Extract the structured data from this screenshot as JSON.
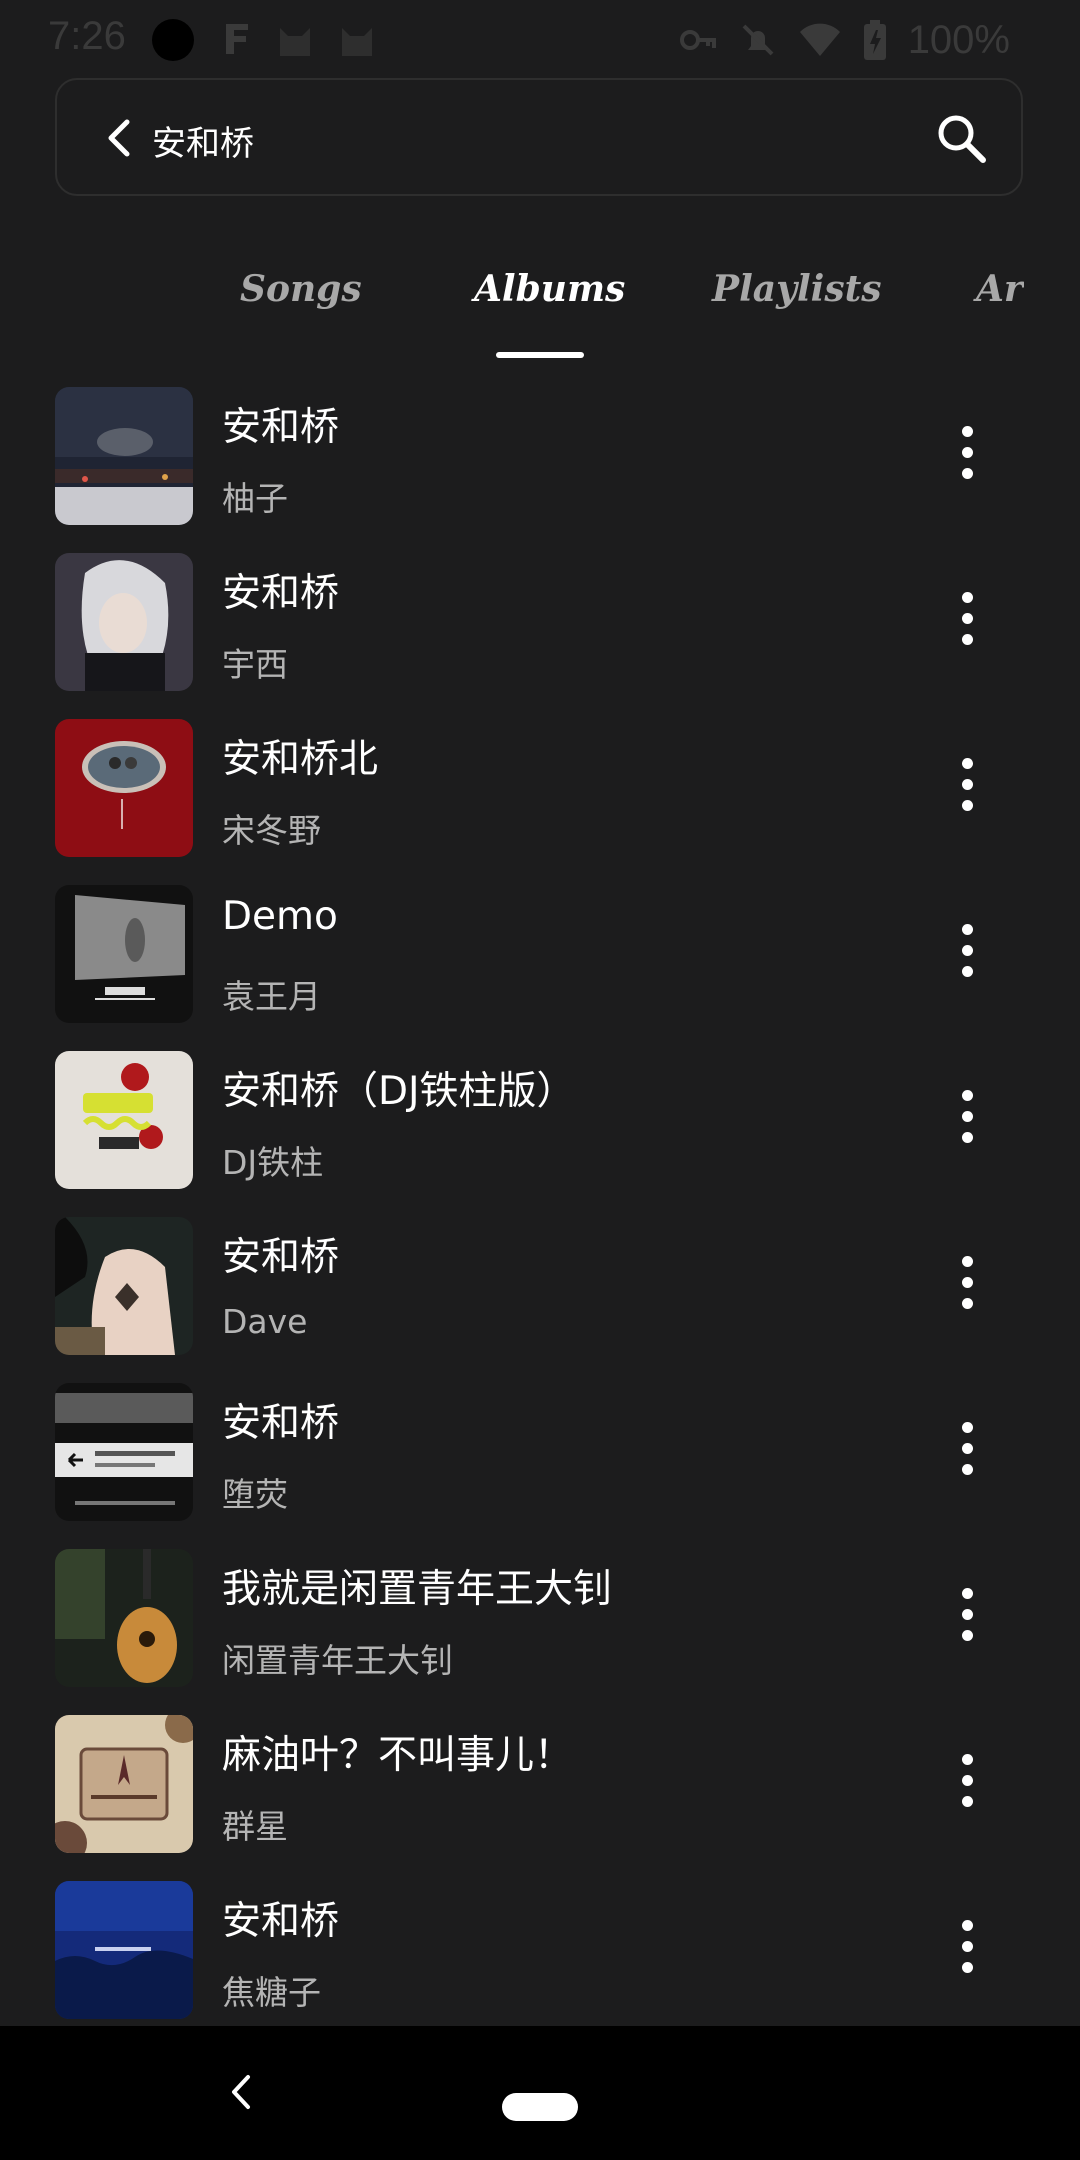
{
  "status_bar": {
    "time": "7:26",
    "battery": "100%"
  },
  "search": {
    "query": "安和桥"
  },
  "tabs": [
    {
      "label": "Songs",
      "active": false
    },
    {
      "label": "Albums",
      "active": true
    },
    {
      "label": "Playlists",
      "active": false
    },
    {
      "label": "Artists",
      "active": false
    }
  ],
  "albums": [
    {
      "title": "安和桥",
      "artist": "柚子",
      "art": "night-sky-city"
    },
    {
      "title": "安和桥",
      "artist": "宇西",
      "art": "anime-girl-white-hair"
    },
    {
      "title": "安和桥北",
      "artist": "宋冬野",
      "art": "red-cover-couple"
    },
    {
      "title": "Demo",
      "artist": "袁王月",
      "art": "dark-room-demo"
    },
    {
      "title": "安和桥（DJ铁柱版）",
      "artist": "DJ铁柱",
      "art": "roses-yellow-text"
    },
    {
      "title": "安和桥",
      "artist": "Dave",
      "art": "back-butterfly"
    },
    {
      "title": "安和桥",
      "artist": "堕荧",
      "art": "subway-sign"
    },
    {
      "title": "我就是闲置青年王大钊",
      "artist": "闲置青年王大钊",
      "art": "acoustic-guitar"
    },
    {
      "title": "麻油叶？不叫事儿！",
      "artist": "群星",
      "art": "paisley-logo"
    },
    {
      "title": "安和桥",
      "artist": "焦糖子",
      "art": "blue-night-sky"
    }
  ],
  "colors": {
    "background": "#1c1c1d",
    "text_primary": "#ffffff",
    "text_secondary": "#b4b4b4",
    "tab_inactive": "#a8a8a8",
    "nav_bar": "#000000"
  }
}
